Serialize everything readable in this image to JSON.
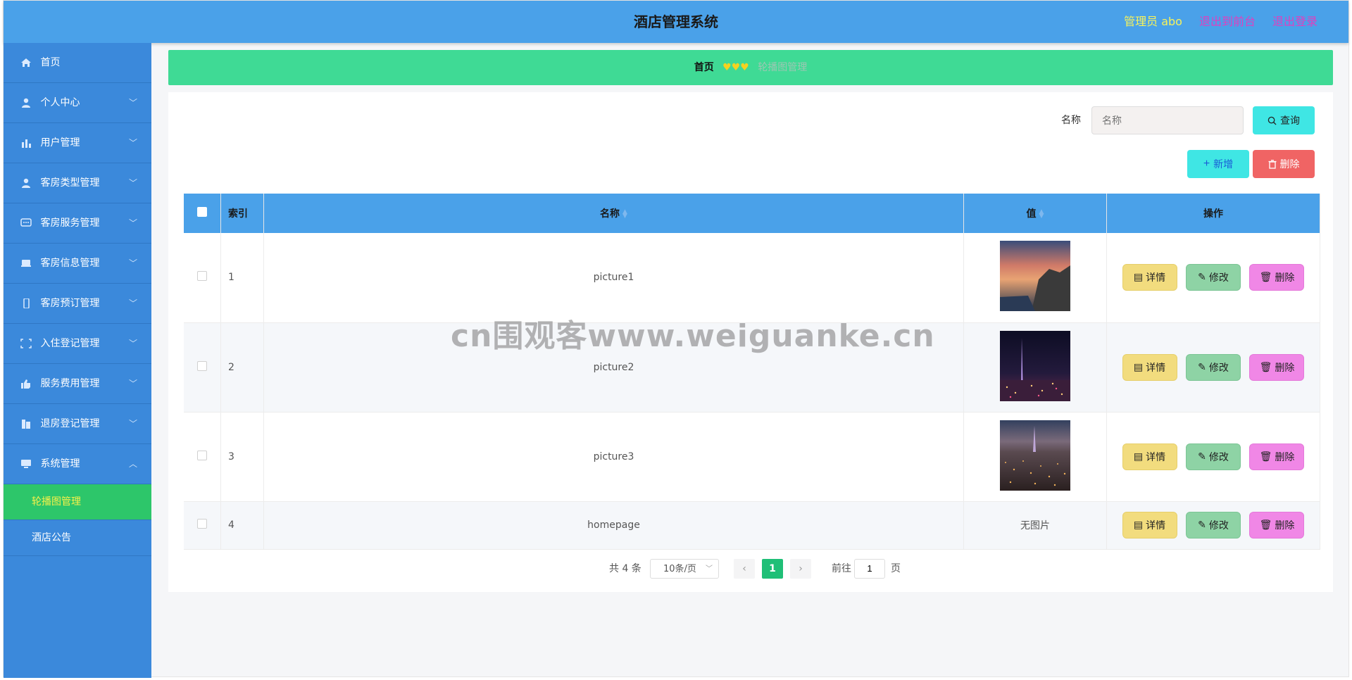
{
  "header": {
    "title": "酒店管理系统",
    "admin_label": "管理员 abo",
    "link_front": "退出到前台",
    "link_logout": "退出登录"
  },
  "sidebar": {
    "items": [
      {
        "label": "首页",
        "icon": "home-icon"
      },
      {
        "label": "个人中心",
        "icon": "user-icon"
      },
      {
        "label": "用户管理",
        "icon": "bar-chart-icon"
      },
      {
        "label": "客房类型管理",
        "icon": "user-icon"
      },
      {
        "label": "客房服务管理",
        "icon": "chat-icon"
      },
      {
        "label": "客房信息管理",
        "icon": "bed-icon"
      },
      {
        "label": "客房预订管理",
        "icon": "mobile-icon"
      },
      {
        "label": "入住登记管理",
        "icon": "frame-icon"
      },
      {
        "label": "服务费用管理",
        "icon": "thumb-icon"
      },
      {
        "label": "退房登记管理",
        "icon": "building-icon"
      },
      {
        "label": "系统管理",
        "icon": "monitor-icon"
      }
    ],
    "sub_items": [
      {
        "label": "轮播图管理",
        "active": true
      },
      {
        "label": "酒店公告",
        "active": false
      }
    ]
  },
  "breadcrumb": {
    "home": "首页",
    "separator": "♥♥♥",
    "current": "轮播图管理"
  },
  "search": {
    "label": "名称",
    "placeholder": "名称",
    "query_label": "查询"
  },
  "toolbar": {
    "add_label": "新增",
    "delete_label": "删除"
  },
  "table": {
    "headers": {
      "index": "索引",
      "name": "名称",
      "value": "值",
      "actions": "操作"
    },
    "rows": [
      {
        "index": "1",
        "name": "picture1",
        "image": "sunset-coast"
      },
      {
        "index": "2",
        "name": "picture2",
        "image": "night-city-tower"
      },
      {
        "index": "3",
        "name": "picture3",
        "image": "night-city-skyline"
      },
      {
        "index": "4",
        "name": "homepage",
        "image": null,
        "no_image_text": "无图片"
      }
    ],
    "row_buttons": {
      "detail": "详情",
      "edit": "修改",
      "delete": "删除"
    }
  },
  "pagination": {
    "total_text": "共 4 条",
    "page_size": "10条/页",
    "current_page": "1",
    "goto_label": "前往",
    "goto_value": "1",
    "page_suffix": "页"
  },
  "watermark": "cn围观客www.weiguanke.cn",
  "colors": {
    "header": "#4aa1e9",
    "sidebar": "#3b89db",
    "active_sub": "#2dc66a",
    "breadcrumb": "#3fda95",
    "accent_cyan": "#3fe6e4",
    "danger": "#f06464"
  }
}
